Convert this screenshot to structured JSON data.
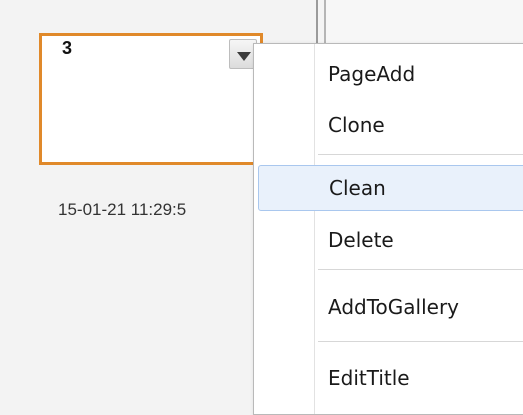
{
  "page_card": {
    "number": "3",
    "timestamp": "15-01-21 11:29:5"
  },
  "context_menu": {
    "items": [
      {
        "label": "PageAdd"
      },
      {
        "label": "Clone"
      },
      {
        "label": "Clean"
      },
      {
        "label": "Delete"
      },
      {
        "label": "AddToGallery"
      },
      {
        "label": "EditTitle"
      }
    ],
    "highlighted": "Clean"
  },
  "colors": {
    "thumb_border": "#e0892a",
    "highlight_bg": "#e9f1fb",
    "highlight_border": "#a9c7ee"
  }
}
